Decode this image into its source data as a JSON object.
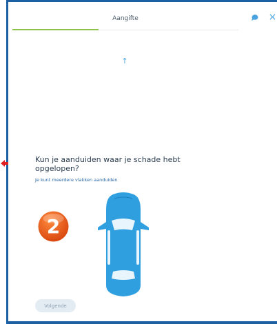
{
  "header": {
    "title": "Aangifte",
    "progress_fraction": 0.38
  },
  "icons": {
    "chat": "chat-bubble-icon",
    "close": "close-icon",
    "up": "up-arrow-icon",
    "pointer": "red-arrow-icon",
    "step": "step-number-badge",
    "car": "car-top-view"
  },
  "close_glyph": "×",
  "up_glyph": "↑",
  "question": {
    "title": "Kun je aanduiden waar je schade hebt opgelopen?",
    "hint": "Je kunt meerdere vlakken aanduiden"
  },
  "step_badge": {
    "number": "2"
  },
  "buttons": {
    "next_label": "Volgende"
  },
  "colors": {
    "frame": "#1d5fa3",
    "accent": "#4aa3df",
    "progress": "#8bc34a",
    "car": "#2f9fe0",
    "badge": "#e8591f"
  }
}
